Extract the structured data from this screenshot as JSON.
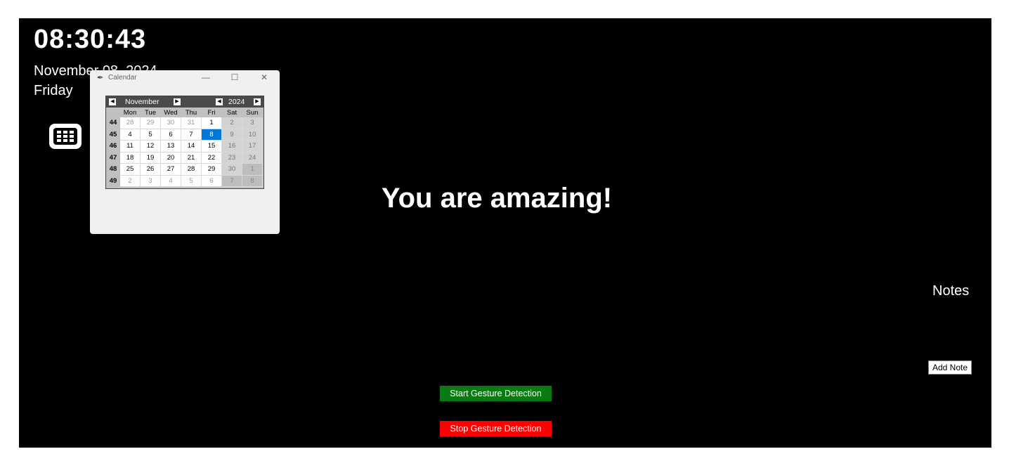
{
  "clock": {
    "time": "08:30:43",
    "date": "November 08, 2024",
    "weekday": "Friday"
  },
  "message": "You are amazing!",
  "notes": {
    "title": "Notes",
    "add_button": "Add Note"
  },
  "gesture": {
    "start_label": "Start Gesture Detection",
    "stop_label": "Stop Gesture Detection",
    "start_color": "#0b7a13",
    "stop_color": "#ff0000"
  },
  "calendar_icon": "calendar-icon",
  "calendar_window": {
    "title": "Calendar",
    "controls": {
      "minimize": "—",
      "maximize": "☐",
      "close": "✕"
    },
    "month": "November",
    "year": "2024",
    "day_headers": [
      "Mon",
      "Tue",
      "Wed",
      "Thu",
      "Fri",
      "Sat",
      "Sun"
    ],
    "selected_day": "8",
    "selection_color": "#0078d7",
    "weeks": [
      {
        "week": "44",
        "days": [
          "28",
          "29",
          "30",
          "31",
          "1",
          "2",
          "3"
        ],
        "other": [
          true,
          true,
          true,
          true,
          false,
          false,
          false
        ]
      },
      {
        "week": "45",
        "days": [
          "4",
          "5",
          "6",
          "7",
          "8",
          "9",
          "10"
        ],
        "other": [
          false,
          false,
          false,
          false,
          false,
          false,
          false
        ]
      },
      {
        "week": "46",
        "days": [
          "11",
          "12",
          "13",
          "14",
          "15",
          "16",
          "17"
        ],
        "other": [
          false,
          false,
          false,
          false,
          false,
          false,
          false
        ]
      },
      {
        "week": "47",
        "days": [
          "18",
          "19",
          "20",
          "21",
          "22",
          "23",
          "24"
        ],
        "other": [
          false,
          false,
          false,
          false,
          false,
          false,
          false
        ]
      },
      {
        "week": "48",
        "days": [
          "25",
          "26",
          "27",
          "28",
          "29",
          "30",
          "1"
        ],
        "other": [
          false,
          false,
          false,
          false,
          false,
          false,
          true
        ]
      },
      {
        "week": "49",
        "days": [
          "2",
          "3",
          "4",
          "5",
          "6",
          "7",
          "8"
        ],
        "other": [
          true,
          true,
          true,
          true,
          true,
          true,
          true
        ]
      }
    ]
  }
}
